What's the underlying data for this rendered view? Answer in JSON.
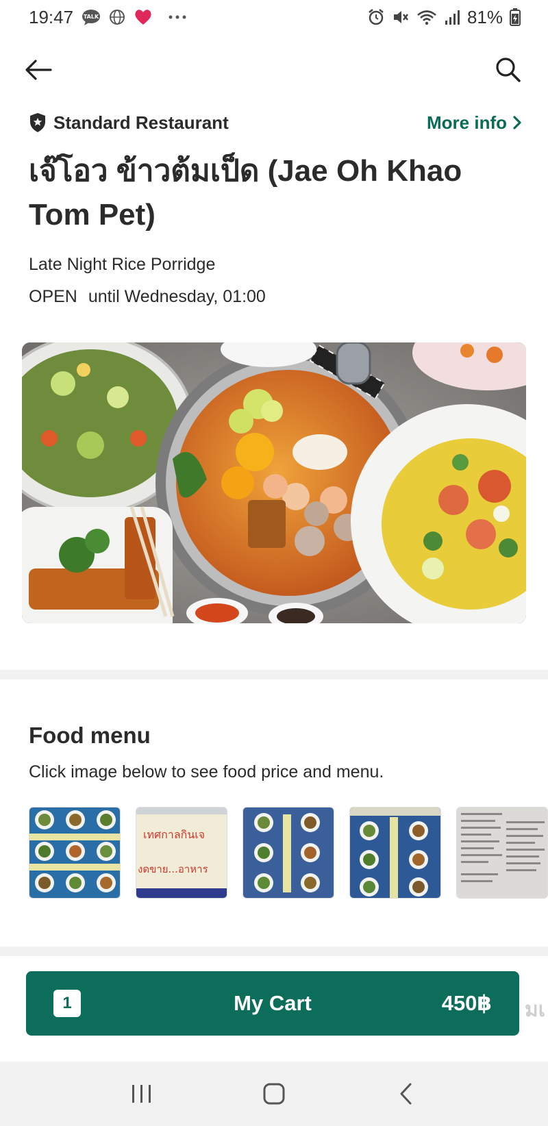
{
  "status_bar": {
    "time": "19:47",
    "battery": "81%",
    "left_icons": [
      "talk-icon",
      "globe-icon",
      "heart-icon",
      "more-dots-icon"
    ],
    "right_icons": [
      "alarm-icon",
      "mute-icon",
      "wifi-icon",
      "signal-icon",
      "battery-icon"
    ]
  },
  "nav": {
    "back_icon": "arrow-left-icon",
    "search_icon": "search-icon"
  },
  "restaurant": {
    "tier": "Standard Restaurant",
    "more_info": "More info",
    "name": "เจ๊โอว ข้าวต้มเป็ด (Jae Oh Khao Tom Pet)",
    "category": "Late Night Rice Porridge",
    "status": "OPEN",
    "hours": "until Wednesday, 01:00"
  },
  "food_menu": {
    "title": "Food menu",
    "subtitle": "Click image below to see food price and menu.",
    "thumbnail_texts": [
      "เทศกาลกินเจ",
      "งดขาย...อาหาร"
    ]
  },
  "cart": {
    "count": "1",
    "label": "My Cart",
    "price": "450฿",
    "peek_text": "มเ"
  },
  "colors": {
    "brand_green": "#0c6d5a",
    "link_green": "#0a6b59",
    "text": "#2b2b2b",
    "divider": "#f1f1f1"
  },
  "android_nav": {
    "icons": [
      "recent-apps-icon",
      "home-icon",
      "back-icon"
    ]
  }
}
